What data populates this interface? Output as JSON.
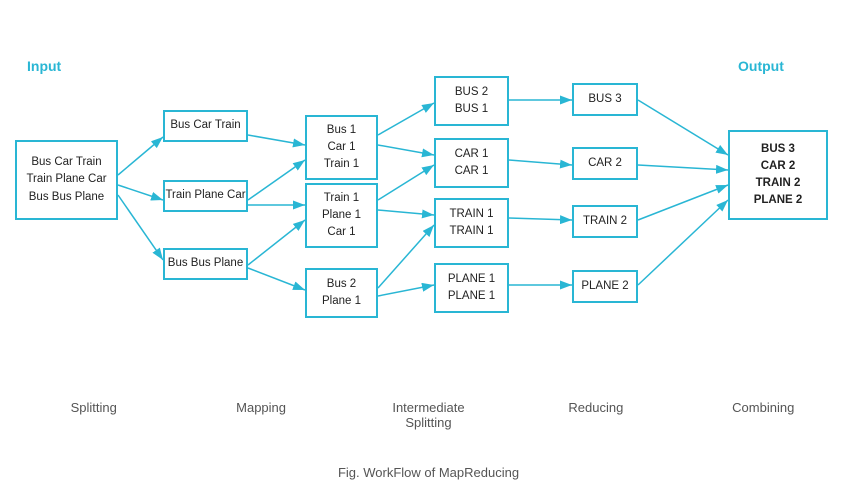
{
  "title": "Fig. WorkFlow of MapReducing",
  "labels": {
    "input": "Input",
    "output": "Output",
    "splitting": "Splitting",
    "mapping": "Mapping",
    "intermediate_splitting": "Intermediate\nSplitting",
    "reducing": "Reducing",
    "combining": "Combining"
  },
  "boxes": {
    "input": "Bus Car Train\nTrain Plane Car\nBus Bus Plane",
    "split1": "Bus Car Train",
    "split2": "Train Plane Car",
    "split3": "Bus Bus Plane",
    "map1": "Bus 1\nCar 1\nTrain 1",
    "map2": "Train 1\nPlane 1\nCar 1",
    "map3": "Bus 2\nPlane 1",
    "inter1": "BUS 2\nBUS 1",
    "inter2": "CAR 1\nCAR 1",
    "inter3": "TRAIN 1\nTRAIN 1",
    "inter4": "PLANE 1\nPLANE 1",
    "reduce1": "BUS 3",
    "reduce2": "CAR 2",
    "reduce3": "TRAIN 2",
    "reduce4": "PLANE 2",
    "output": "BUS 3\nCAR 2\nTRAIN 2\nPLANE 2"
  }
}
